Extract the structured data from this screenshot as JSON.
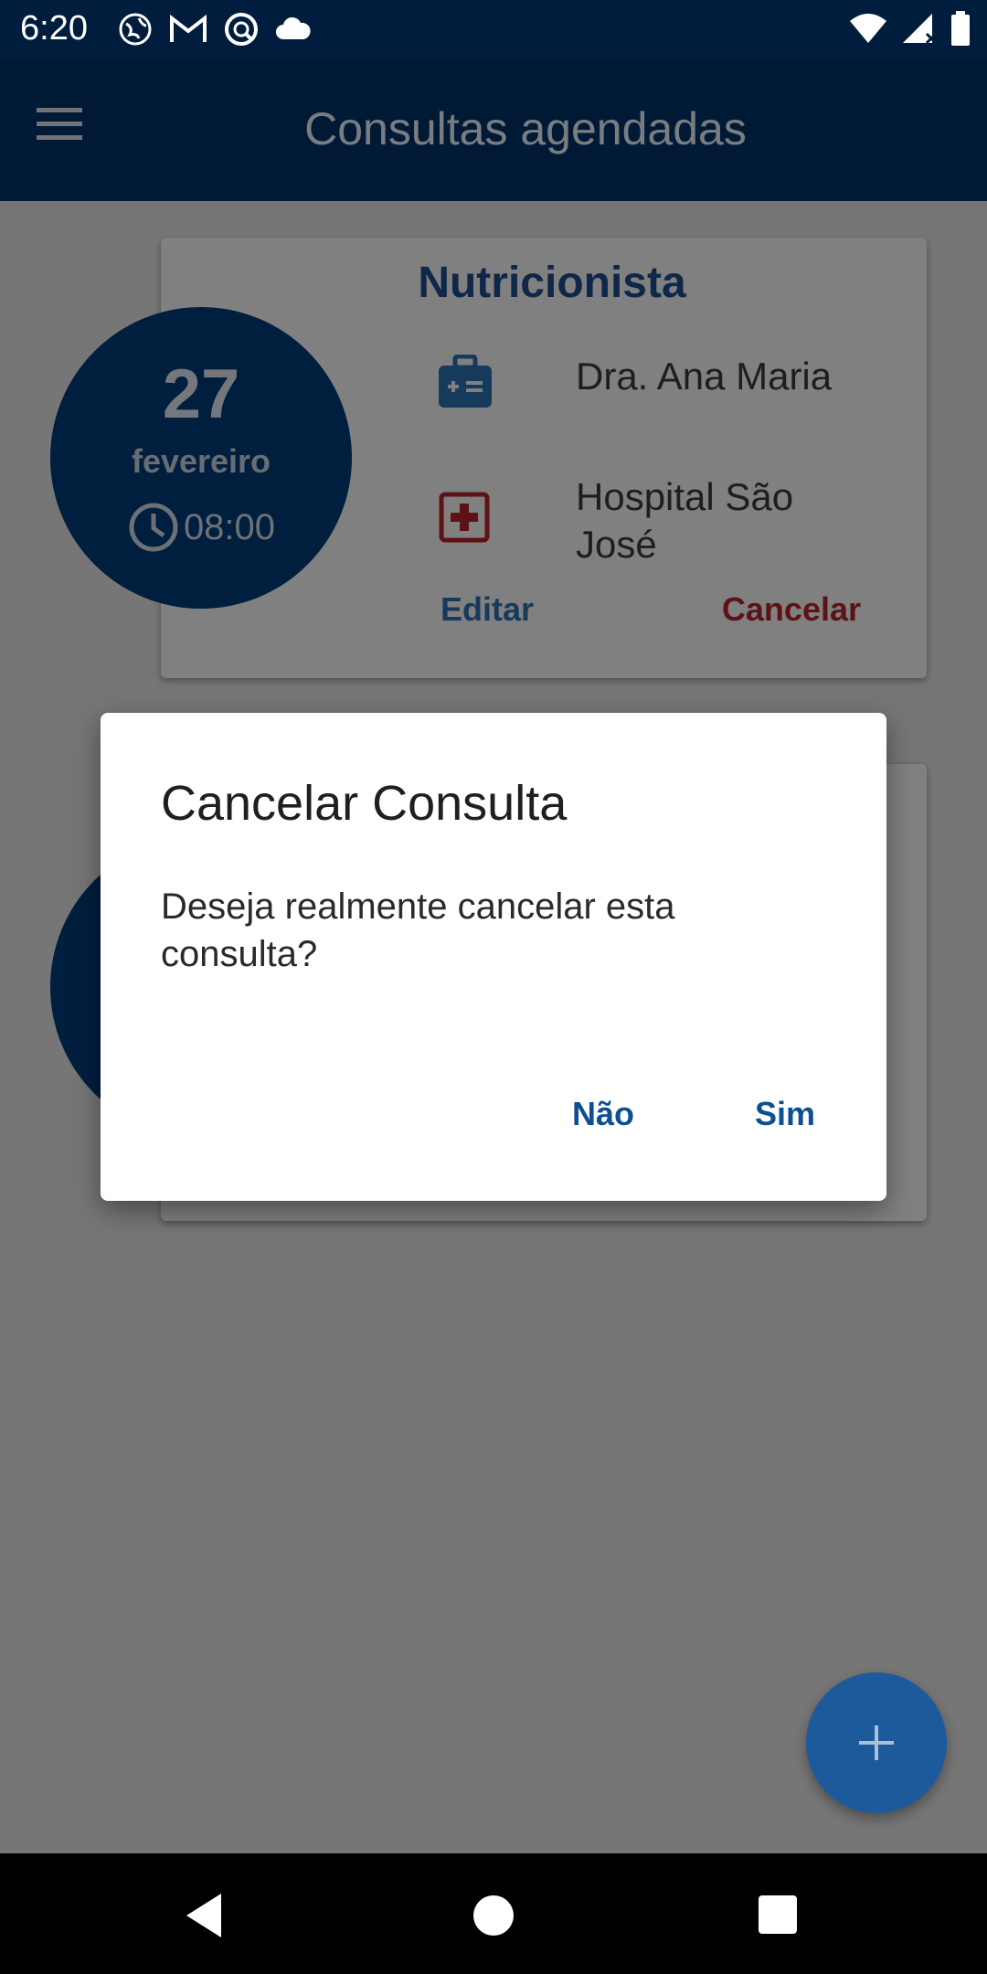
{
  "status_bar": {
    "time": "6:20",
    "left_icons": [
      "globe-icon",
      "gmail-icon",
      "app-icon",
      "cloud-icon"
    ],
    "right_icons": [
      "wifi-icon",
      "signal-icon",
      "battery-icon"
    ]
  },
  "app_bar": {
    "title": "Consultas agendadas",
    "menu_icon": "hamburger-menu-icon"
  },
  "appointments": [
    {
      "day": "27",
      "month": "fevereiro",
      "time": "08:00",
      "specialty": "Nutricionista",
      "doctor": "Dra. Ana Maria",
      "hospital": "Hospital São José",
      "edit_label": "Editar",
      "cancel_label": "Cancelar"
    }
  ],
  "dialog": {
    "title": "Cancelar Consulta",
    "message": "Deseja realmente cancelar esta consulta?",
    "no_label": "Não",
    "yes_label": "Sim"
  },
  "fab": {
    "icon": "plus-icon"
  },
  "colors": {
    "primary": "#003366",
    "accent": "#1c5a9c",
    "danger": "#b3262b"
  }
}
